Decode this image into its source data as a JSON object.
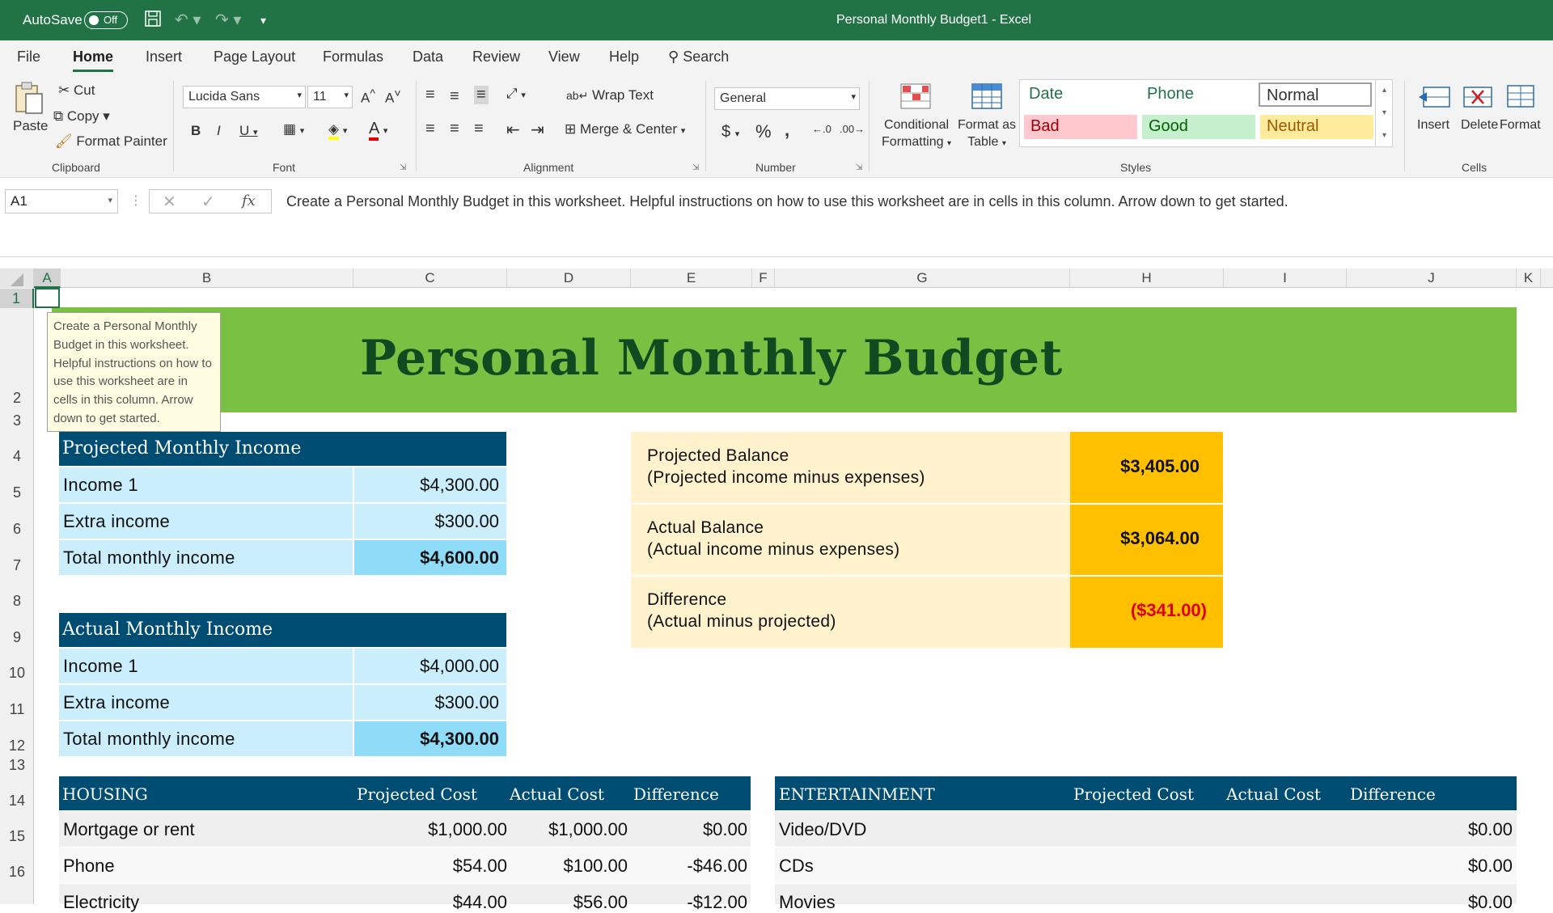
{
  "titlebar": {
    "autosave_label": "AutoSave",
    "autosave_state": "Off",
    "document_title": "Personal Monthly Budget1  -  Excel"
  },
  "ribbon_tabs": [
    "File",
    "Home",
    "Insert",
    "Page Layout",
    "Formulas",
    "Data",
    "Review",
    "View",
    "Help"
  ],
  "search_label": "Search",
  "clipboard": {
    "paste": "Paste",
    "cut": "Cut",
    "copy": "Copy",
    "format_painter": "Format Painter",
    "group": "Clipboard"
  },
  "font": {
    "name": "Lucida Sans",
    "size": "11",
    "group": "Font"
  },
  "alignment": {
    "wrap_text": "Wrap Text",
    "merge_center": "Merge & Center",
    "group": "Alignment"
  },
  "number": {
    "format": "General",
    "group": "Number"
  },
  "styles": {
    "conditional_formatting_1": "Conditional",
    "conditional_formatting_2": "Formatting",
    "format_as_table_1": "Format as",
    "format_as_table_2": "Table",
    "date": "Date",
    "phone": "Phone",
    "normal": "Normal",
    "bad": "Bad",
    "good": "Good",
    "neutral": "Neutral",
    "group": "Styles"
  },
  "cells": {
    "insert": "Insert",
    "delete": "Delete",
    "format": "Format",
    "group": "Cells"
  },
  "formula_bar": {
    "name_box": "A1",
    "fx": "fx",
    "content": "Create a Personal Monthly Budget in this worksheet. Helpful instructions on how to use this worksheet are in cells in this column. Arrow down to get started."
  },
  "columns": [
    "A",
    "B",
    "C",
    "D",
    "E",
    "F",
    "G",
    "H",
    "I",
    "J",
    "K"
  ],
  "rows": [
    "1",
    "2",
    "3",
    "4",
    "5",
    "6",
    "7",
    "8",
    "9",
    "10",
    "11",
    "12",
    "13",
    "14",
    "15",
    "16"
  ],
  "tooltip": "Create a Personal Monthly Budget in this worksheet. Helpful instructions on how to use this worksheet are in cells in this column. Arrow down to get started.",
  "sheet_title": "Personal Monthly Budget",
  "projected_income": {
    "title": "Projected Monthly Income",
    "rows": [
      {
        "label": "Income 1",
        "value": "$4,300.00"
      },
      {
        "label": "Extra income",
        "value": "$300.00"
      },
      {
        "label": "Total monthly income",
        "value": "$4,600.00"
      }
    ]
  },
  "actual_income": {
    "title": "Actual Monthly Income",
    "rows": [
      {
        "label": "Income 1",
        "value": "$4,000.00"
      },
      {
        "label": "Extra income",
        "value": "$300.00"
      },
      {
        "label": "Total monthly income",
        "value": "$4,300.00"
      }
    ]
  },
  "balances": [
    {
      "line1": "Projected Balance",
      "line2": "(Projected income minus expenses)",
      "value": "$3,405.00",
      "negative": false
    },
    {
      "line1": "Actual Balance",
      "line2": "(Actual income minus expenses)",
      "value": "$3,064.00",
      "negative": false
    },
    {
      "line1": "Difference",
      "line2": "(Actual minus projected)",
      "value": "($341.00)",
      "negative": true
    }
  ],
  "housing": {
    "header": [
      "HOUSING",
      "Projected Cost",
      "Actual Cost",
      "Difference"
    ],
    "rows": [
      {
        "label": "Mortgage or rent",
        "projected": "$1,000.00",
        "actual": "$1,000.00",
        "difference": "$0.00"
      },
      {
        "label": "Phone",
        "projected": "$54.00",
        "actual": "$100.00",
        "difference": "-$46.00"
      },
      {
        "label": "Electricity",
        "projected": "$44.00",
        "actual": "$56.00",
        "difference": "-$12.00"
      }
    ]
  },
  "entertainment": {
    "header": [
      "ENTERTAINMENT",
      "Projected Cost",
      "Actual Cost",
      "Difference"
    ],
    "rows": [
      {
        "label": "Video/DVD",
        "projected": "",
        "actual": "",
        "difference": "$0.00"
      },
      {
        "label": "CDs",
        "projected": "",
        "actual": "",
        "difference": "$0.00"
      },
      {
        "label": "Movies",
        "projected": "",
        "actual": "",
        "difference": "$0.00"
      }
    ]
  },
  "colors": {
    "excel_green": "#217346",
    "banner_green": "#7ac143",
    "table_header": "#004d73",
    "income_row": "#cbeefc",
    "income_total": "#8fdcf8",
    "balance_label_bg": "#fff2cc",
    "balance_value_bg": "#ffc000",
    "negative_red": "#e00000"
  }
}
